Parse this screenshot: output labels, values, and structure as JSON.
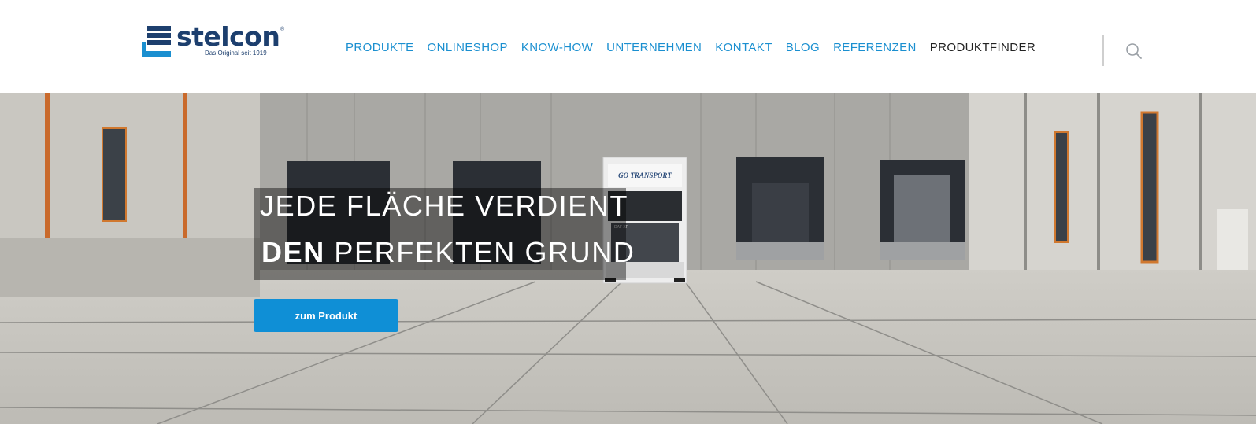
{
  "brand": {
    "name": "stelcon",
    "registered": "®",
    "tagline": "Das Original seit 1919",
    "primary_color": "#1d3f6e",
    "accent_color": "#1a8fd0"
  },
  "nav": {
    "items": [
      {
        "label": "PRODUKTE"
      },
      {
        "label": "ONLINESHOP"
      },
      {
        "label": "KNOW-HOW"
      },
      {
        "label": "UNTERNEHMEN"
      },
      {
        "label": "KONTAKT"
      },
      {
        "label": "BLOG"
      },
      {
        "label": "REFERENZEN"
      },
      {
        "label": "PRODUKTFINDER"
      }
    ],
    "search_icon": "search-icon"
  },
  "hero": {
    "headline_line1": "JEDE FLÄCHE VERDIENT",
    "headline_line2_bold": "DEN",
    "headline_line2_rest": " PERFEKTEN GRUND",
    "cta_label": "zum Produkt",
    "truck_text": "GO TRANSPORT",
    "truck_model": "DAF XF"
  }
}
